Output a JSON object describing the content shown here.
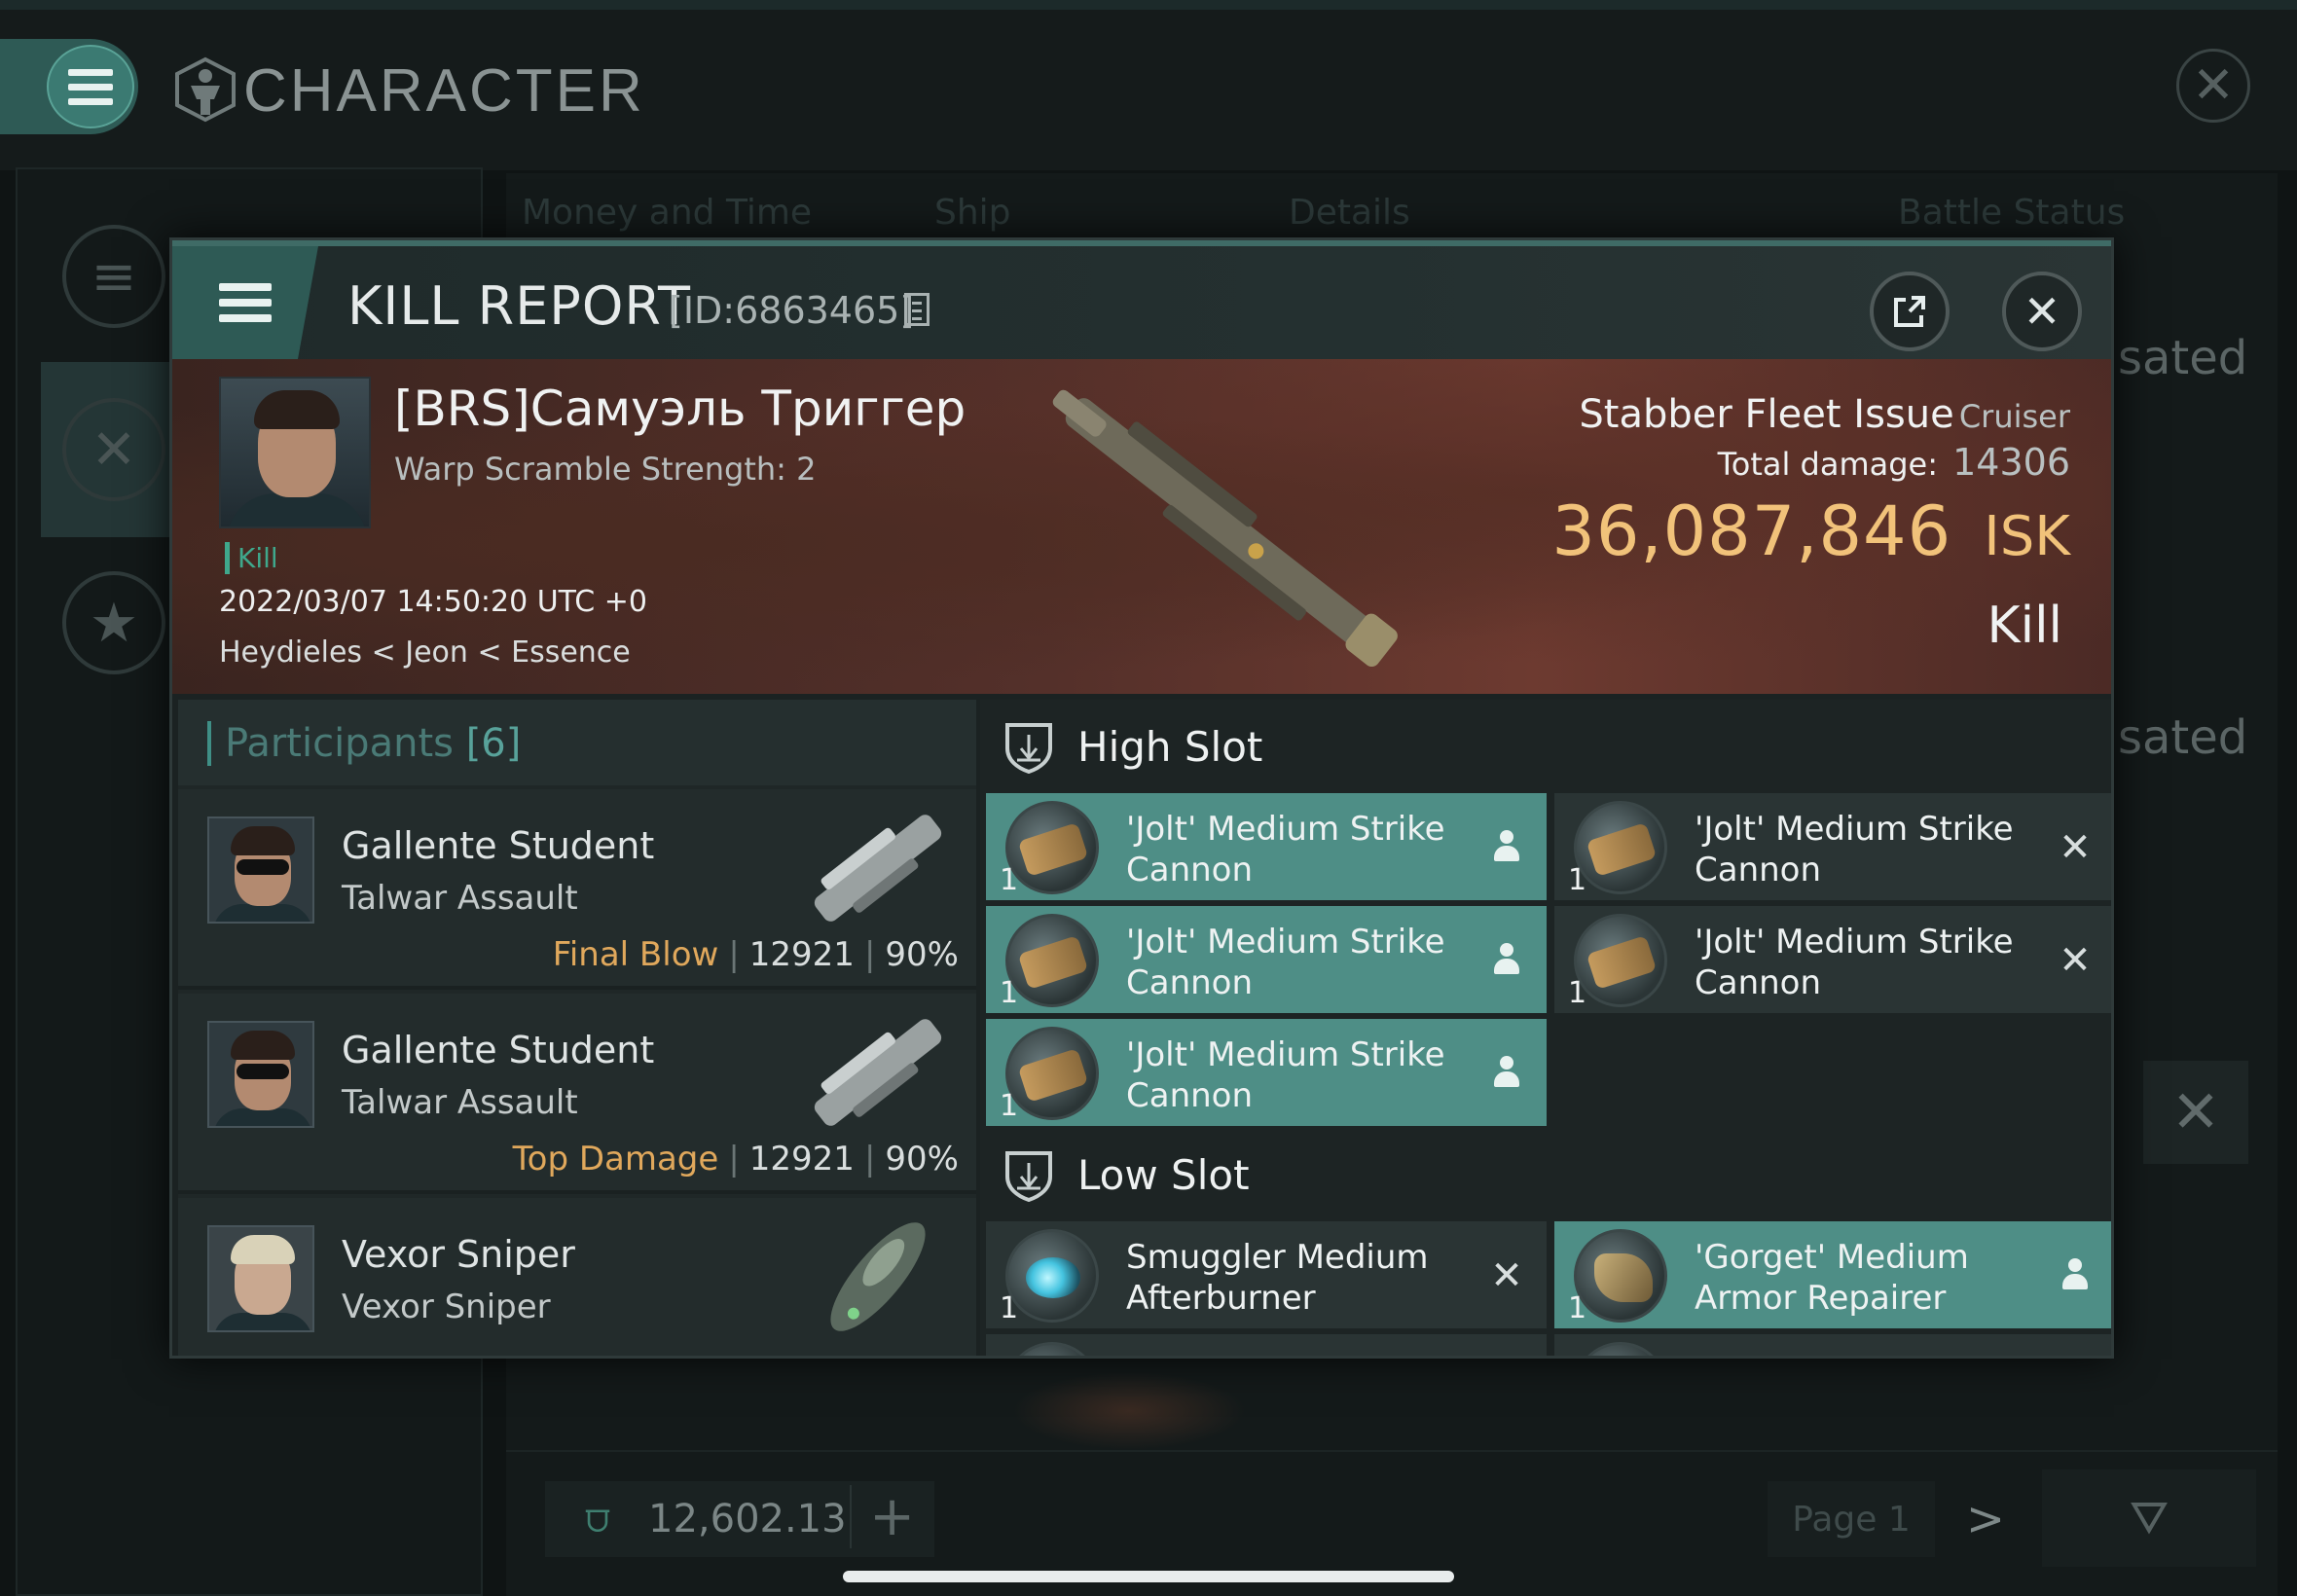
{
  "app": {
    "title": "CHARACTER",
    "icons": {
      "menu": "menu-icon",
      "character": "character-icon",
      "close": "close-icon"
    }
  },
  "background": {
    "tabs": [
      "Money and Time",
      "Ship",
      "Details",
      "Battle Status"
    ],
    "status_fragments": [
      "sated",
      "sated"
    ],
    "wallet": {
      "value": "12,602.13",
      "plus": "+"
    },
    "pager": {
      "label": "Page 1",
      "next": ">"
    }
  },
  "kill_report": {
    "title": "KILL REPORT",
    "id": "[ID:6863465]",
    "victim": {
      "name": "[BRS]Самуэль Триггер",
      "subtitle": "Warp Scramble Strength: 2",
      "tag": "Kill",
      "time": "2022/03/07 14:50:20 UTC +0",
      "location": "Heydieles < Jeon < Essence"
    },
    "ship": {
      "name": "Stabber Fleet Issue",
      "class": "Cruiser",
      "total_damage_label": "Total damage:",
      "total_damage": "14306",
      "isk_value": "36,087,846",
      "isk_unit": "ISK",
      "status": "Kill"
    },
    "participants": {
      "label": "Participants",
      "count": "[6]",
      "rows": [
        {
          "name": "Gallente Student",
          "ship": "Talwar Assault",
          "tag": "Final Blow",
          "damage": "12921",
          "percent": "90%"
        },
        {
          "name": "Gallente Student",
          "ship": "Talwar Assault",
          "tag": "Top Damage",
          "damage": "12921",
          "percent": "90%"
        },
        {
          "name": "Vexor Sniper",
          "ship": "Vexor Sniper",
          "tag": "",
          "damage": "",
          "percent": ""
        }
      ]
    },
    "slots": {
      "high": {
        "label": "High Slot",
        "modules": [
          {
            "name": "'Jolt' Medium Strike Cannon",
            "qty": "1",
            "status": "person-icon",
            "highlight": true
          },
          {
            "name": "'Jolt' Medium Strike Cannon",
            "qty": "1",
            "status": "x-icon",
            "highlight": false
          },
          {
            "name": "'Jolt' Medium Strike Cannon",
            "qty": "1",
            "status": "person-icon",
            "highlight": true
          },
          {
            "name": "'Jolt' Medium Strike Cannon",
            "qty": "1",
            "status": "x-icon",
            "highlight": false
          },
          {
            "name": "'Jolt' Medium Strike Cannon",
            "qty": "1",
            "status": "person-icon",
            "highlight": true
          }
        ]
      },
      "low": {
        "label": "Low Slot",
        "modules": [
          {
            "name": "Smuggler Medium Afterburner",
            "qty": "1",
            "status": "x-icon",
            "highlight": false
          },
          {
            "name": "'Gorget' Medium Armor Repairer",
            "qty": "1",
            "status": "person-icon",
            "highlight": true
          }
        ]
      }
    },
    "colors": {
      "accent": "#4e8e86",
      "isk": "#f1c27a",
      "final_blow": "#e0a85c",
      "kill_tag": "#3fa88c"
    }
  }
}
